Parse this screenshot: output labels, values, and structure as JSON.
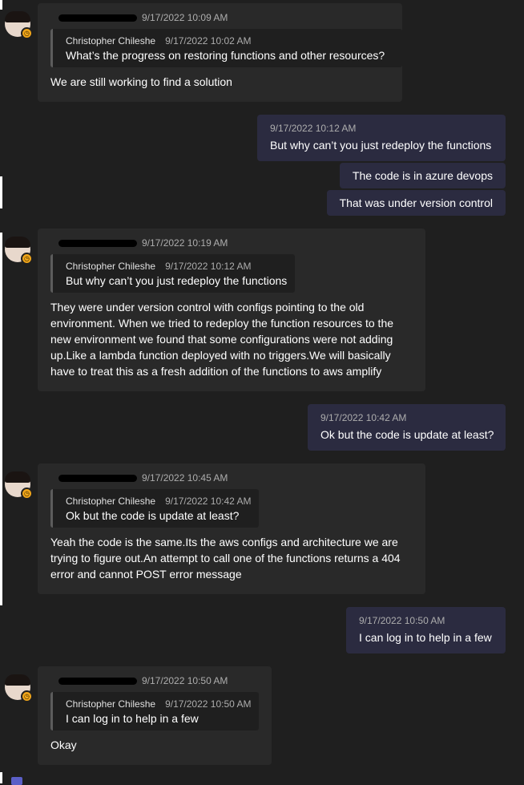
{
  "messages": [
    {
      "timestamp": "9/17/2022 10:09 AM",
      "quote": {
        "sender": "Christopher Chileshe",
        "time": "9/17/2022 10:02 AM",
        "text": "What’s the progress on restoring functions and other resources?"
      },
      "body": "We are still working to find a solution"
    },
    {
      "out_timestamp": "9/17/2022 10:12 AM",
      "out_text": "But why can’t you just redeploy the functions",
      "followups": [
        "The code is in azure devops",
        "That was under version control"
      ]
    },
    {
      "timestamp": "9/17/2022 10:19 AM",
      "quote": {
        "sender": "Christopher Chileshe",
        "time": "9/17/2022 10:12 AM",
        "text": "But why can’t you just redeploy the functions"
      },
      "body_lines": [
        "They were under version control with configs pointing to the old",
        "environment. When we tried to redeploy the function resources to the",
        "new environment we found that some configurations were not adding",
        "up.Like a lambda function deployed with no triggers.We will basically",
        "have to treat this as a fresh addition of the functions to aws amplify"
      ]
    },
    {
      "out_timestamp": "9/17/2022 10:42 AM",
      "out_text": "Ok but the code is update at least?"
    },
    {
      "timestamp": "9/17/2022 10:45 AM",
      "quote": {
        "sender": "Christopher Chileshe",
        "time": "9/17/2022 10:42 AM",
        "text": "Ok but the code is update at least?"
      },
      "body_lines": [
        "Yeah the code is the same.Its the aws configs and architecture we are",
        "trying to figure out.An attempt to call one of the functions returns a 404",
        "error and cannot POST error message"
      ]
    },
    {
      "out_timestamp": "9/17/2022 10:50 AM",
      "out_text": "I can log in to help in a few"
    },
    {
      "timestamp": "9/17/2022 10:50 AM",
      "quote": {
        "sender": "Christopher Chileshe",
        "time": "9/17/2022 10:50 AM",
        "text": "I can log in to help in a few"
      },
      "body": "Okay"
    }
  ],
  "colors": {
    "background": "#1f1f1f",
    "incoming_bubble": "#292929",
    "outgoing_bubble": "#2b2b40",
    "status_away": "#f0a51a"
  },
  "icons": {
    "avatar_status": "clock-icon"
  }
}
